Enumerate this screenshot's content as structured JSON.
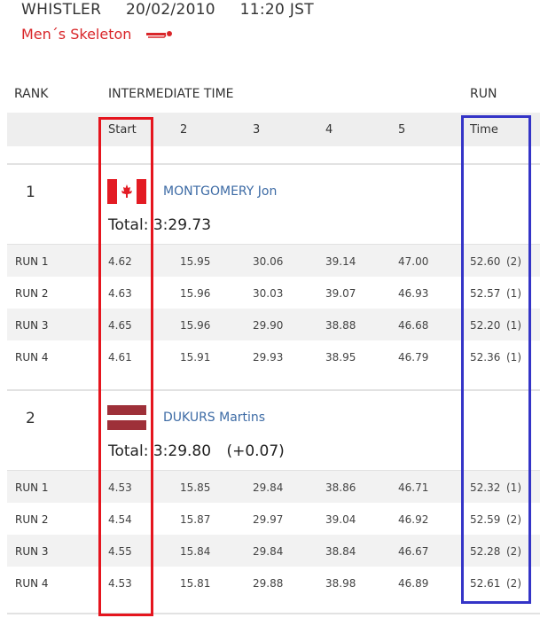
{
  "header": {
    "venue": "WHISTLER",
    "date": "20/02/2010",
    "time": "11:20 JST",
    "event": "Men´s Skeleton",
    "event_icon": "skeleton-sled-icon"
  },
  "table": {
    "rank_header": "RANK",
    "intermediate_header": "INTERMEDIATE TIME",
    "run_header": "RUN",
    "subheaders": [
      "Start",
      "2",
      "3",
      "4",
      "5",
      "Time"
    ]
  },
  "athletes": [
    {
      "rank": "1",
      "name": "MONTGOMERY Jon",
      "country_flag": "canada-flag-icon",
      "total_label": "Total: 3:29.73",
      "diff": "",
      "runs": [
        {
          "label": "RUN 1",
          "splits": [
            "4.62",
            "15.95",
            "30.06",
            "39.14",
            "47.00"
          ],
          "time": "52.60",
          "pos": "(2)"
        },
        {
          "label": "RUN 2",
          "splits": [
            "4.63",
            "15.96",
            "30.03",
            "39.07",
            "46.93"
          ],
          "time": "52.57",
          "pos": "(1)"
        },
        {
          "label": "RUN 3",
          "splits": [
            "4.65",
            "15.96",
            "29.90",
            "38.88",
            "46.68"
          ],
          "time": "52.20",
          "pos": "(1)"
        },
        {
          "label": "RUN 4",
          "splits": [
            "4.61",
            "15.91",
            "29.93",
            "38.95",
            "46.79"
          ],
          "time": "52.36",
          "pos": "(1)"
        }
      ]
    },
    {
      "rank": "2",
      "name": "DUKURS Martins",
      "country_flag": "latvia-flag-icon",
      "total_label": "Total: 3:29.80",
      "diff": "(+0.07)",
      "runs": [
        {
          "label": "RUN 1",
          "splits": [
            "4.53",
            "15.85",
            "29.84",
            "38.86",
            "46.71"
          ],
          "time": "52.32",
          "pos": "(1)"
        },
        {
          "label": "RUN 2",
          "splits": [
            "4.54",
            "15.87",
            "29.97",
            "39.04",
            "46.92"
          ],
          "time": "52.59",
          "pos": "(2)"
        },
        {
          "label": "RUN 3",
          "splits": [
            "4.55",
            "15.84",
            "29.84",
            "38.84",
            "46.67"
          ],
          "time": "52.28",
          "pos": "(2)"
        },
        {
          "label": "RUN 4",
          "splits": [
            "4.53",
            "15.81",
            "29.88",
            "38.98",
            "46.89"
          ],
          "time": "52.61",
          "pos": "(2)"
        }
      ]
    }
  ],
  "colors": {
    "accent": "#d9262a",
    "link": "#3d6ba5",
    "highlight_start": "#e5151e",
    "highlight_time": "#3434c7",
    "canada_red": "#e31b23",
    "latvia_red": "#9e3039"
  }
}
